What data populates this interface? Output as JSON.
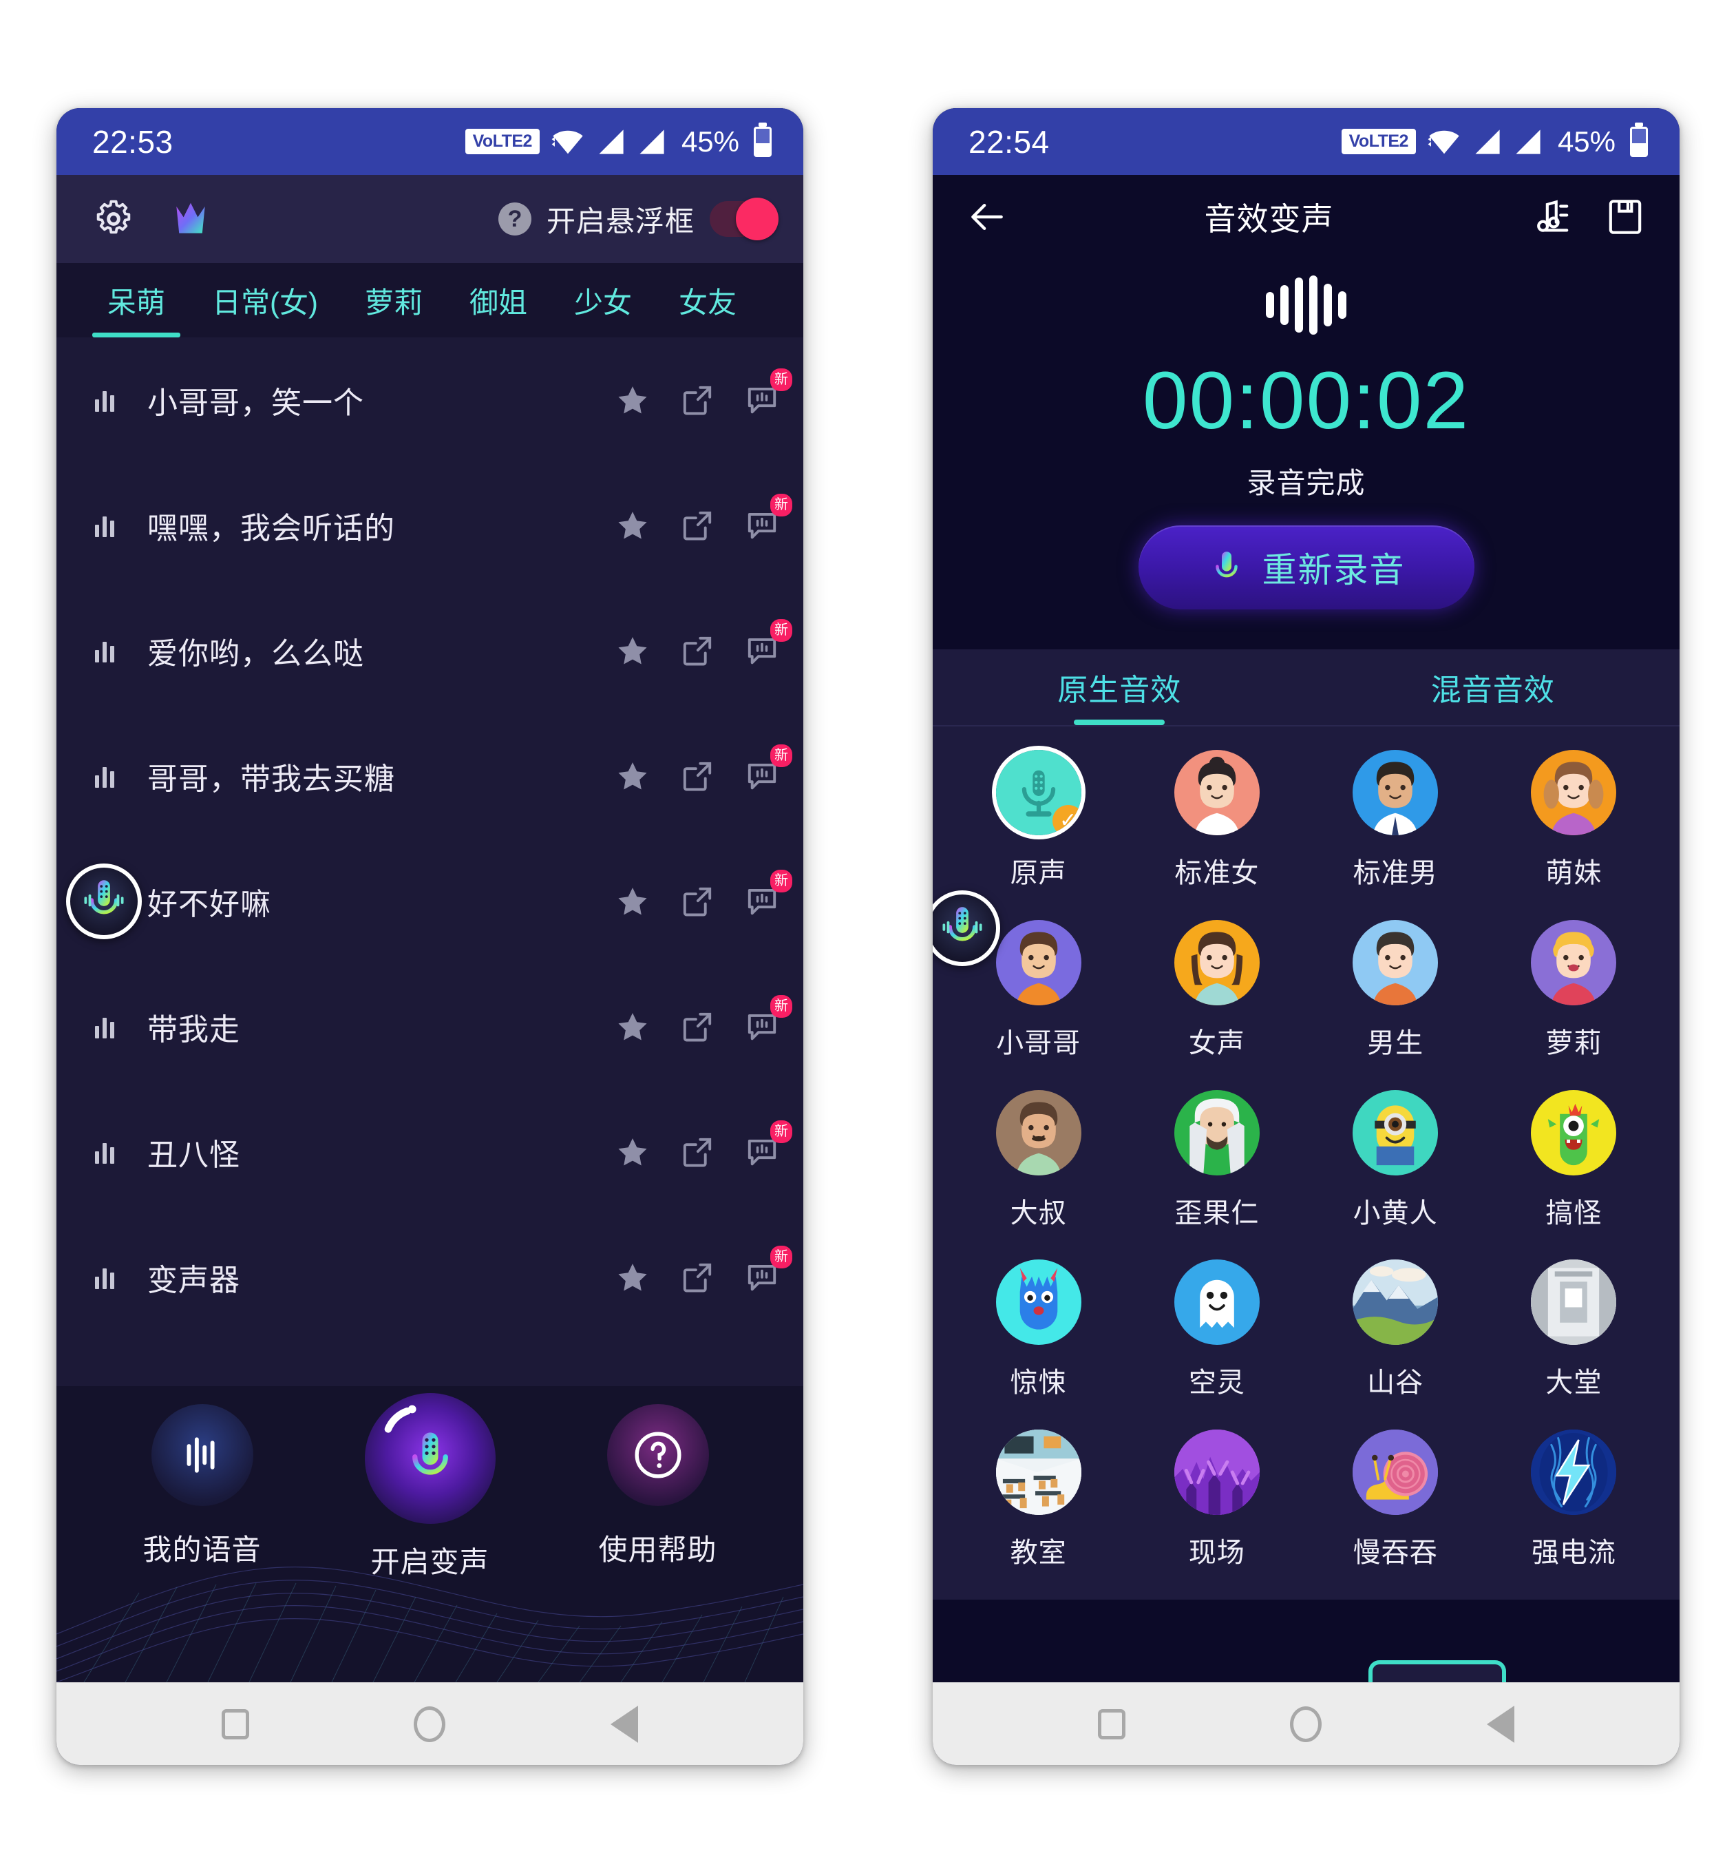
{
  "phone1": {
    "status_bar": {
      "time": "22:53",
      "network_badge": "VoLTE2",
      "battery_percent": "45%",
      "icons": [
        "wifi-icon",
        "signal-icon",
        "signal-icon",
        "battery-icon"
      ]
    },
    "topbar": {
      "settings_icon": "gear-icon",
      "logo_icon": "crown-logo-icon",
      "help_icon": "question-mark-icon",
      "float_window_label": "开启悬浮框",
      "toggle_state": "on",
      "toggle_color": "#fb2a63"
    },
    "tabs": {
      "active_index": 0,
      "accent_color": "#3fdec7",
      "items": [
        {
          "label": "呆萌"
        },
        {
          "label": "日常(女)"
        },
        {
          "label": "萝莉"
        },
        {
          "label": "御姐"
        },
        {
          "label": "少女"
        },
        {
          "label": "女友"
        }
      ]
    },
    "list": {
      "row_icons": [
        "star-icon",
        "share-icon",
        "comment-icon"
      ],
      "badge_text": "新",
      "badge_color": "#f81f64",
      "items": [
        {
          "title": "小哥哥，笑一个"
        },
        {
          "title": "嘿嘿，我会听话的"
        },
        {
          "title": "爱你哟，么么哒"
        },
        {
          "title": "哥哥，带我去买糖"
        },
        {
          "title": "好不好嘛"
        },
        {
          "title": "带我走"
        },
        {
          "title": "丑八怪"
        },
        {
          "title": "变声器"
        }
      ]
    },
    "floating_widget": {
      "icon": "floating-mic-icon"
    },
    "bottom_nav": {
      "items": [
        {
          "label": "我的语音",
          "icon": "waveform-icon"
        },
        {
          "label": "开启变声",
          "icon": "microphone-icon"
        },
        {
          "label": "使用帮助",
          "icon": "question-mark-icon"
        }
      ]
    }
  },
  "phone2": {
    "status_bar": {
      "time": "22:54",
      "network_badge": "VoLTE2",
      "battery_percent": "45%"
    },
    "header": {
      "back_icon": "arrow-left-icon",
      "title": "音效变声",
      "music_icon": "music-note-list-icon",
      "save_icon": "save-floppy-icon"
    },
    "recorder": {
      "wave_icon": "audio-waveform-icon",
      "timer": "00:00:02",
      "timer_color": "#3ee6cf",
      "status": "录音完成",
      "button_label": "重新录音",
      "button_icon": "microphone-icon"
    },
    "tabs": {
      "active_index": 0,
      "accent_color": "#3fdec7",
      "items": [
        {
          "label": "原生音效"
        },
        {
          "label": "混音音效"
        }
      ]
    },
    "voice_grid": {
      "selected_index": 0,
      "check_badge": "✓",
      "items": [
        {
          "label": "原声",
          "icon": "mic-avatar-icon",
          "bg": "#4fe0cd"
        },
        {
          "label": "标准女",
          "icon": "woman-avatar-icon",
          "bg": "#f2917e"
        },
        {
          "label": "标准男",
          "icon": "man-avatar-icon",
          "bg": "#2f9ae8"
        },
        {
          "label": "萌妹",
          "icon": "cute-girl-avatar-icon",
          "bg": "#f49a1e"
        },
        {
          "label": "小哥哥",
          "icon": "young-man-avatar-icon",
          "bg": "#7a6bdf"
        },
        {
          "label": "女声",
          "icon": "female-avatar-icon",
          "bg": "#f6a81c"
        },
        {
          "label": "男生",
          "icon": "boy-avatar-icon",
          "bg": "#8fc9f3"
        },
        {
          "label": "萝莉",
          "icon": "loli-avatar-icon",
          "bg": "#8a6fd6"
        },
        {
          "label": "大叔",
          "icon": "uncle-avatar-icon",
          "bg": "#9a7b63"
        },
        {
          "label": "歪果仁",
          "icon": "foreigner-avatar-icon",
          "bg": "#2bb34a"
        },
        {
          "label": "小黄人",
          "icon": "minion-avatar-icon",
          "bg": "#3fd7c0"
        },
        {
          "label": "搞怪",
          "icon": "monster-avatar-icon",
          "bg": "#f2e520"
        },
        {
          "label": "惊悚",
          "icon": "horror-avatar-icon",
          "bg": "#44e8e8"
        },
        {
          "label": "空灵",
          "icon": "ghost-avatar-icon",
          "bg": "#36a8ea"
        },
        {
          "label": "山谷",
          "icon": "valley-avatar-icon",
          "bg": "#7fa8c8"
        },
        {
          "label": "大堂",
          "icon": "hall-avatar-icon",
          "bg": "#c9cdd2"
        },
        {
          "label": "教室",
          "icon": "classroom-avatar-icon",
          "bg": "#d7e2e8"
        },
        {
          "label": "现场",
          "icon": "concert-avatar-icon",
          "bg": "#b45df0"
        },
        {
          "label": "慢吞吞",
          "icon": "snail-avatar-icon",
          "bg": "#7b6bd8"
        },
        {
          "label": "强电流",
          "icon": "lightning-avatar-icon",
          "bg": "#1036c4"
        }
      ]
    },
    "floating_widget": {
      "icon": "floating-mic-icon"
    }
  },
  "android_nav": {
    "items": [
      {
        "icon": "recents-square-icon"
      },
      {
        "icon": "home-circle-icon"
      },
      {
        "icon": "back-triangle-icon"
      }
    ]
  }
}
